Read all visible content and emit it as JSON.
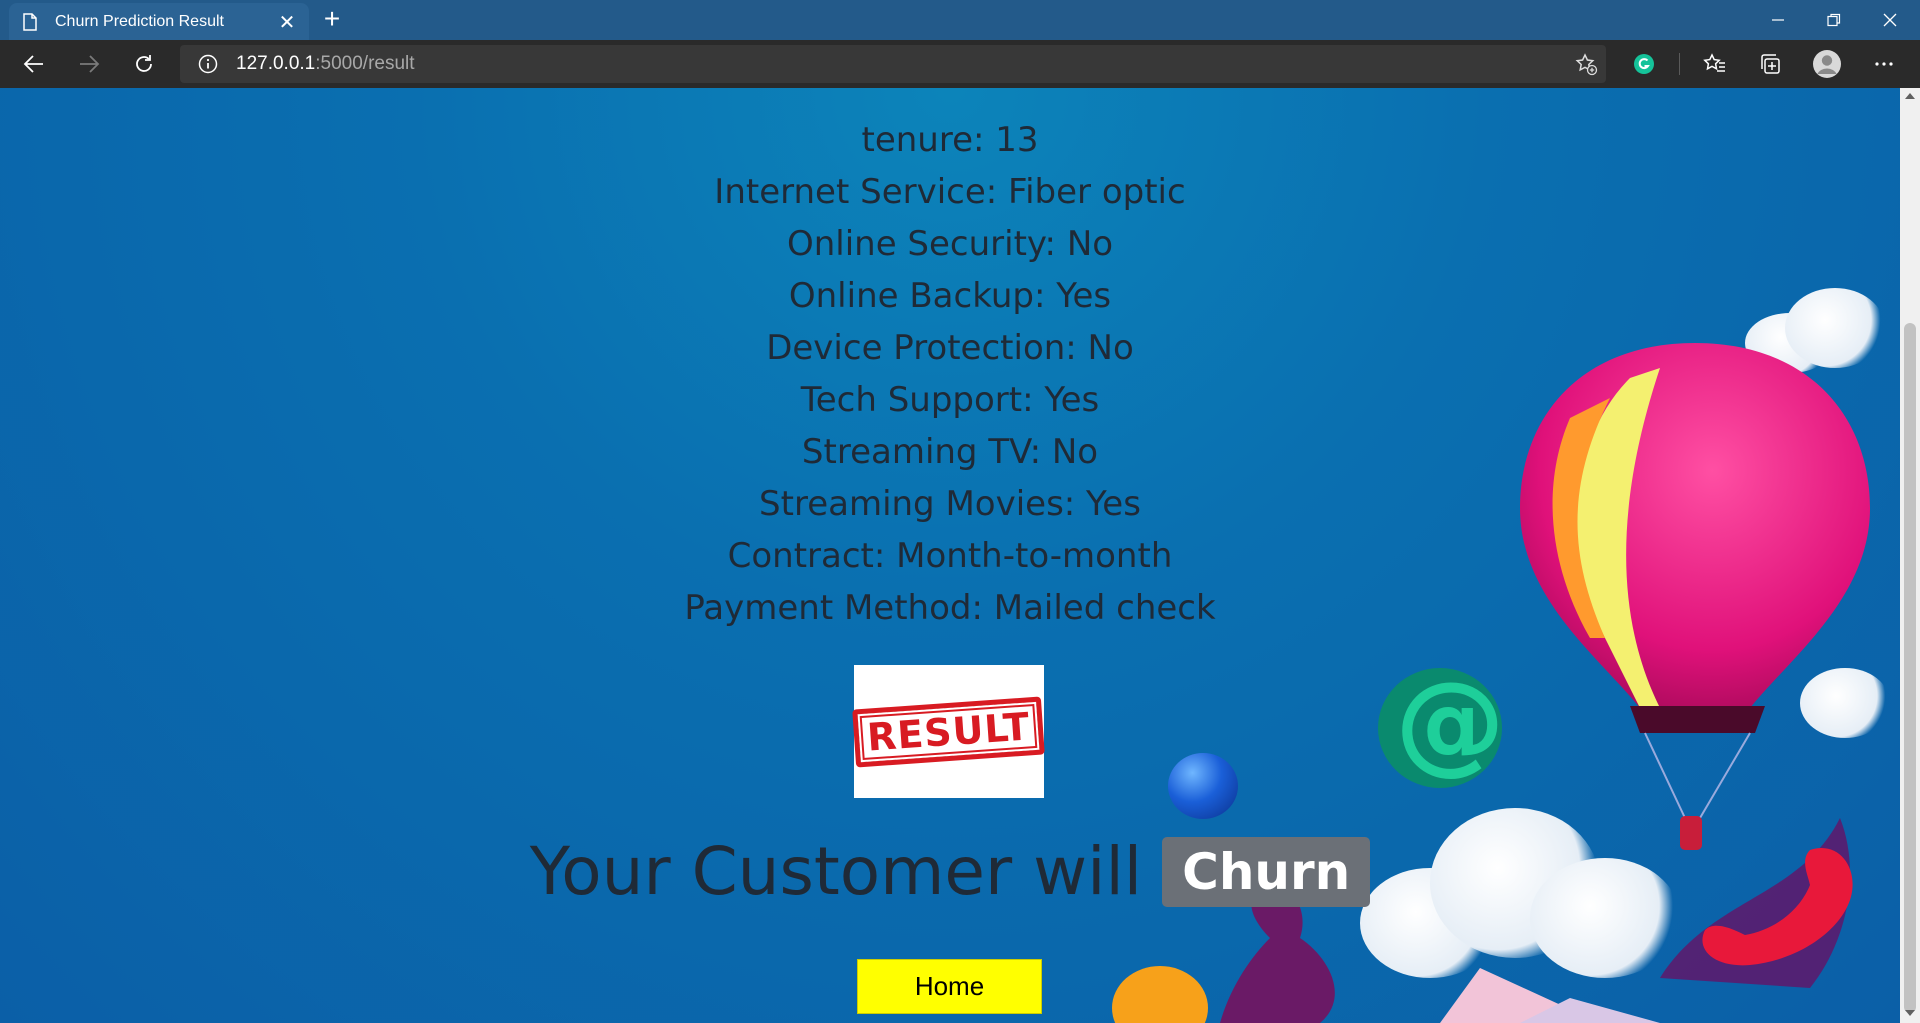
{
  "browser": {
    "tab_title": "Churn Prediction Result",
    "tab_close": "✕",
    "new_tab": "+",
    "url_host": "127.0.0.1",
    "url_rest": ":5000/result"
  },
  "fields": [
    {
      "label": "tenure",
      "value": "13",
      "text": "tenure: 13"
    },
    {
      "label": "Internet Service",
      "value": "Fiber optic",
      "text": "Internet Service: Fiber optic"
    },
    {
      "label": "Online Security",
      "value": "No",
      "text": "Online Security: No"
    },
    {
      "label": "Online Backup",
      "value": "Yes",
      "text": "Online Backup: Yes"
    },
    {
      "label": "Device Protection",
      "value": "No",
      "text": "Device Protection: No"
    },
    {
      "label": "Tech Support",
      "value": "Yes",
      "text": "Tech Support: Yes"
    },
    {
      "label": "Streaming TV",
      "value": "No",
      "text": "Streaming TV: No"
    },
    {
      "label": "Streaming Movies",
      "value": "Yes",
      "text": "Streaming Movies: Yes"
    },
    {
      "label": "Contract",
      "value": "Month-to-month",
      "text": "Contract: Month-to-month"
    },
    {
      "label": "Payment Method",
      "value": "Mailed check",
      "text": "Payment Method: Mailed check"
    }
  ],
  "result_image": {
    "stamp_text": "RESULT"
  },
  "verdict": {
    "prefix": "Your Customer will",
    "badge": "Churn"
  },
  "home_button": {
    "label": "Home"
  },
  "colors": {
    "background": "#0b63a6",
    "badge": "#6b7077",
    "home_button": "#ffff00",
    "stamp": "#d81b22"
  }
}
